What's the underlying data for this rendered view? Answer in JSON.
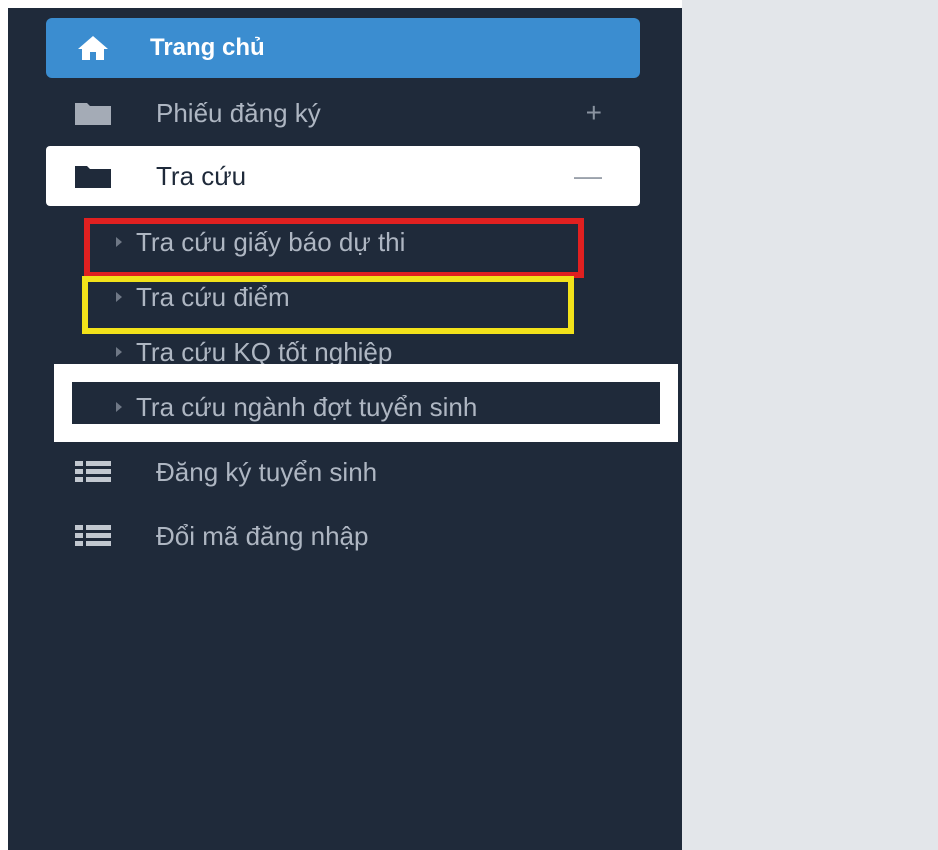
{
  "sidebar": {
    "home": {
      "label": "Trang chủ",
      "icon": "home-icon"
    },
    "items": [
      {
        "label": "Phiếu đăng ký",
        "icon": "folder-icon",
        "toggle": "+"
      },
      {
        "label": "Tra cứu",
        "icon": "folder-open-icon",
        "toggle": "—"
      },
      {
        "label": "Đăng ký tuyển sinh",
        "icon": "list-icon"
      },
      {
        "label": "Đổi mã đăng nhập",
        "icon": "list-icon"
      }
    ],
    "submenu": [
      {
        "label": "Tra cứu giấy báo dự thi"
      },
      {
        "label": "Tra cứu điểm"
      },
      {
        "label": "Tra cứu KQ tốt nghiệp"
      },
      {
        "label": "Tra cứu ngành đợt tuyển sinh"
      }
    ]
  },
  "colors": {
    "sidebar_bg": "#1f2a3a",
    "active_blue": "#3b8dd0",
    "highlight_red": "#e02020",
    "highlight_yellow": "#f2e21a",
    "highlight_white": "#ffffff"
  }
}
